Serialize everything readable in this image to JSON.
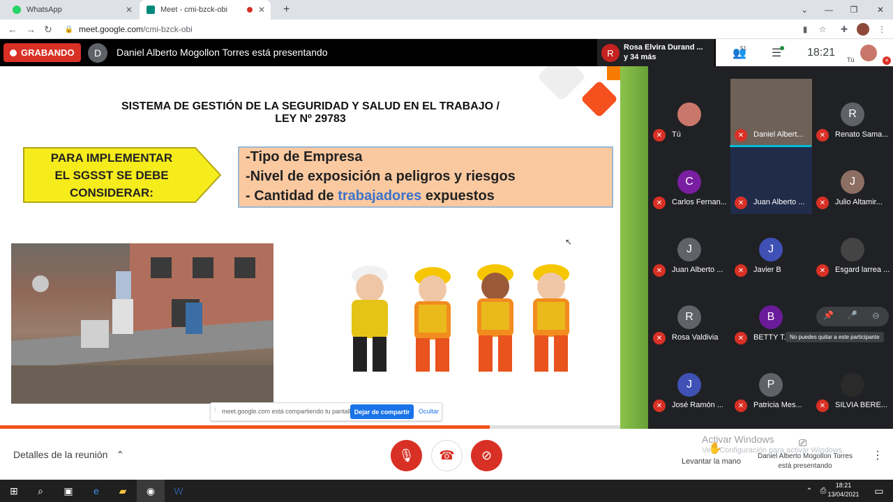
{
  "browser": {
    "tabs": [
      {
        "label": "WhatsApp",
        "active": false
      },
      {
        "label": "Meet - cmi-bzck-obi",
        "active": true
      }
    ],
    "new_tab": "+",
    "url_host": "meet.google.com",
    "url_path": "/cmi-bzck-obi"
  },
  "meet_top": {
    "recording": "GRABANDO",
    "presenter_initial": "D",
    "presenter_text": "Daniel Alberto Mogollon Torres está presentando",
    "speaker_initial": "R",
    "speaker_line1": "Rosa Elvira Durand ...",
    "speaker_line2": "y 34 más",
    "participant_count": "51",
    "time": "18:21",
    "self_label": "Tú"
  },
  "slide": {
    "title_line1": "SISTEMA DE GESTIÓN DE LA SEGURIDAD Y SALUD EN EL TRABAJO /",
    "title_line2": "LEY Nº 29783",
    "arrow_line1": "PARA IMPLEMENTAR",
    "arrow_line2": "EL SGSST SE DEBE",
    "arrow_line3": "CONSIDERAR:",
    "item1": "-Tipo de Empresa",
    "item2": "-Nivel de exposición a peligros y riesgos",
    "item3_pre": "- Cantidad de ",
    "item3_blue": "trabajadores",
    "item3_post": " expuestos",
    "progress_fraction": 0.79
  },
  "share_notice": {
    "text": "meet.google.com está compartiendo tu pantalla.",
    "stop_label": "Dejar de compartir",
    "hide_label": "Ocultar"
  },
  "participants": [
    {
      "name": "Tú",
      "initial": "",
      "color": "#c9776a"
    },
    {
      "name": "Daniel Albert...",
      "initial": "",
      "color": "#6d6158"
    },
    {
      "name": "Renato Sama...",
      "initial": "R",
      "color": "#5f6368"
    },
    {
      "name": "Carlos Fernan...",
      "initial": "C",
      "color": "#7b1fa2"
    },
    {
      "name": "Juan Alberto ...",
      "initial": "",
      "color": "#202c4a"
    },
    {
      "name": "Julio Altamir...",
      "initial": "J",
      "color": "#8d6e63"
    },
    {
      "name": "Juan Alberto ...",
      "initial": "J",
      "color": "#5f6368"
    },
    {
      "name": "Javier B",
      "initial": "J",
      "color": "#3f51b5"
    },
    {
      "name": "Esgard larrea ...",
      "initial": "",
      "color": "#444"
    },
    {
      "name": "Rosa Valdivia",
      "initial": "R",
      "color": "#5f6368"
    },
    {
      "name": "BETTY T...",
      "initial": "B",
      "color": "#6a1b9a"
    },
    {
      "name": "",
      "initial": "",
      "color": "#202124"
    },
    {
      "name": "José Ramón ...",
      "initial": "J",
      "color": "#3f51b5"
    },
    {
      "name": "Patricia Mes...",
      "initial": "P",
      "color": "#5f6368"
    },
    {
      "name": "SILVIA BERE...",
      "initial": "",
      "color": "#2a2a2a"
    }
  ],
  "tooltip": "No puedes quitar a este participante",
  "bottom": {
    "details": "Detalles de la reunión",
    "raise_hand": "Levantar la mano",
    "presenting_line1": "Daniel Alberto Mogollon Torres",
    "presenting_line2": "está presentando",
    "watermark1": "Activar Windows",
    "watermark2": "Ve a Configuración para activar Windows."
  },
  "taskbar": {
    "time": "18:21",
    "date": "13/04/2021"
  }
}
